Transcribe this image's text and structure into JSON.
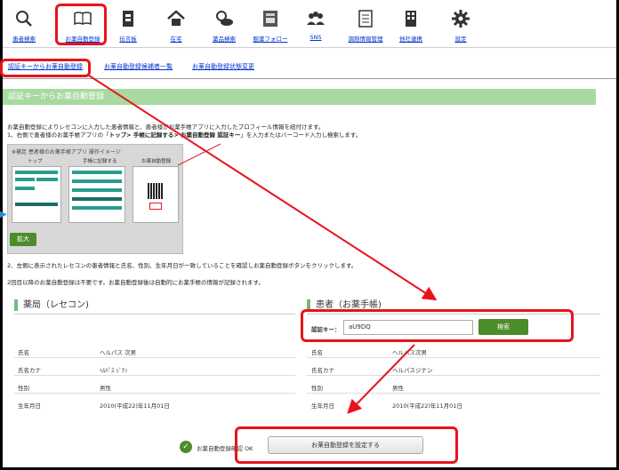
{
  "toolbar": {
    "items": [
      {
        "label": "患者検索",
        "icon": "search-icon"
      },
      {
        "label": "お薬自動登録",
        "icon": "book-icon"
      },
      {
        "label": "伝言板",
        "icon": "message-board-icon"
      },
      {
        "label": "在宅",
        "icon": "home-icon"
      },
      {
        "label": "薬品検索",
        "icon": "medicine-icon"
      },
      {
        "label": "服薬フォロー",
        "icon": "followup-icon"
      },
      {
        "label": "SNS",
        "icon": "people-icon"
      },
      {
        "label": "調剤情報管理",
        "icon": "document-icon"
      },
      {
        "label": "他社連携",
        "icon": "building-icon"
      },
      {
        "label": "設定",
        "icon": "gear-icon"
      }
    ]
  },
  "tabs": [
    "認証キーからお薬自動登録",
    "お薬自動登録候補者一覧",
    "お薬自動登録状態変更"
  ],
  "banner": "認証キーからお薬自動登録",
  "intro": {
    "line1": "お薬自動登録によりレセコンに入力した患者情報と、患者様がお薬手帳アプリに入力したプロフィール情報を紐付けます。",
    "line2_pre": "1、右側で患者様のお薬手帳アプリの「",
    "line2_bold": "トップ> 手帳に記録する> お薬自動登録 認証キー",
    "line2_post": "」を入力またはバーコード入力し検索します。"
  },
  "illustration": {
    "caption": "※補足 患者様のお薬手帳アプリ 操作イメージ",
    "step1": "トップ",
    "step2": "手帳に記録する",
    "step3": "お薬自動登録",
    "zoom_label": "拡大"
  },
  "step2_text": "2、左側に表示されたレセコンの患者情報と氏名、性別、生年月日が一致していることを確認しお薬自動登録ボタンをクリックします。",
  "note_text": "2回目以降のお薬自動登録は不要です。お薬自動登録後は自動的にお薬手帳の情報が記録されます。",
  "left_section": {
    "title": "薬局（レセコン)",
    "rows": [
      {
        "label": "氏名",
        "value": "ヘルパス 次男"
      },
      {
        "label": "氏名カナ",
        "value": "ﾍﾙﾊﾟｽ ｼﾞﾅﾝ"
      },
      {
        "label": "性別",
        "value": "男性"
      },
      {
        "label": "生年月日",
        "value": "2010(平成22)年11月01日"
      }
    ]
  },
  "right_section": {
    "title": "患者（お薬手帳)",
    "key_label": "認証キー：",
    "key_value": "aU9DQ",
    "search_label": "検索",
    "rows": [
      {
        "label": "氏名",
        "value": "ヘルパス次男"
      },
      {
        "label": "氏名カナ",
        "value": "ヘルパスジナン"
      },
      {
        "label": "性別",
        "value": "男性"
      },
      {
        "label": "生年月日",
        "value": "2010(平成22)年11月01日"
      }
    ]
  },
  "footer": {
    "ok_text": "お薬自動登録確認 OK",
    "register_label": "お薬自動登録を設定する"
  },
  "colors": {
    "highlight": "#e8141c",
    "accent_green": "#4c8c2b",
    "banner_green": "#a8d9a0"
  }
}
